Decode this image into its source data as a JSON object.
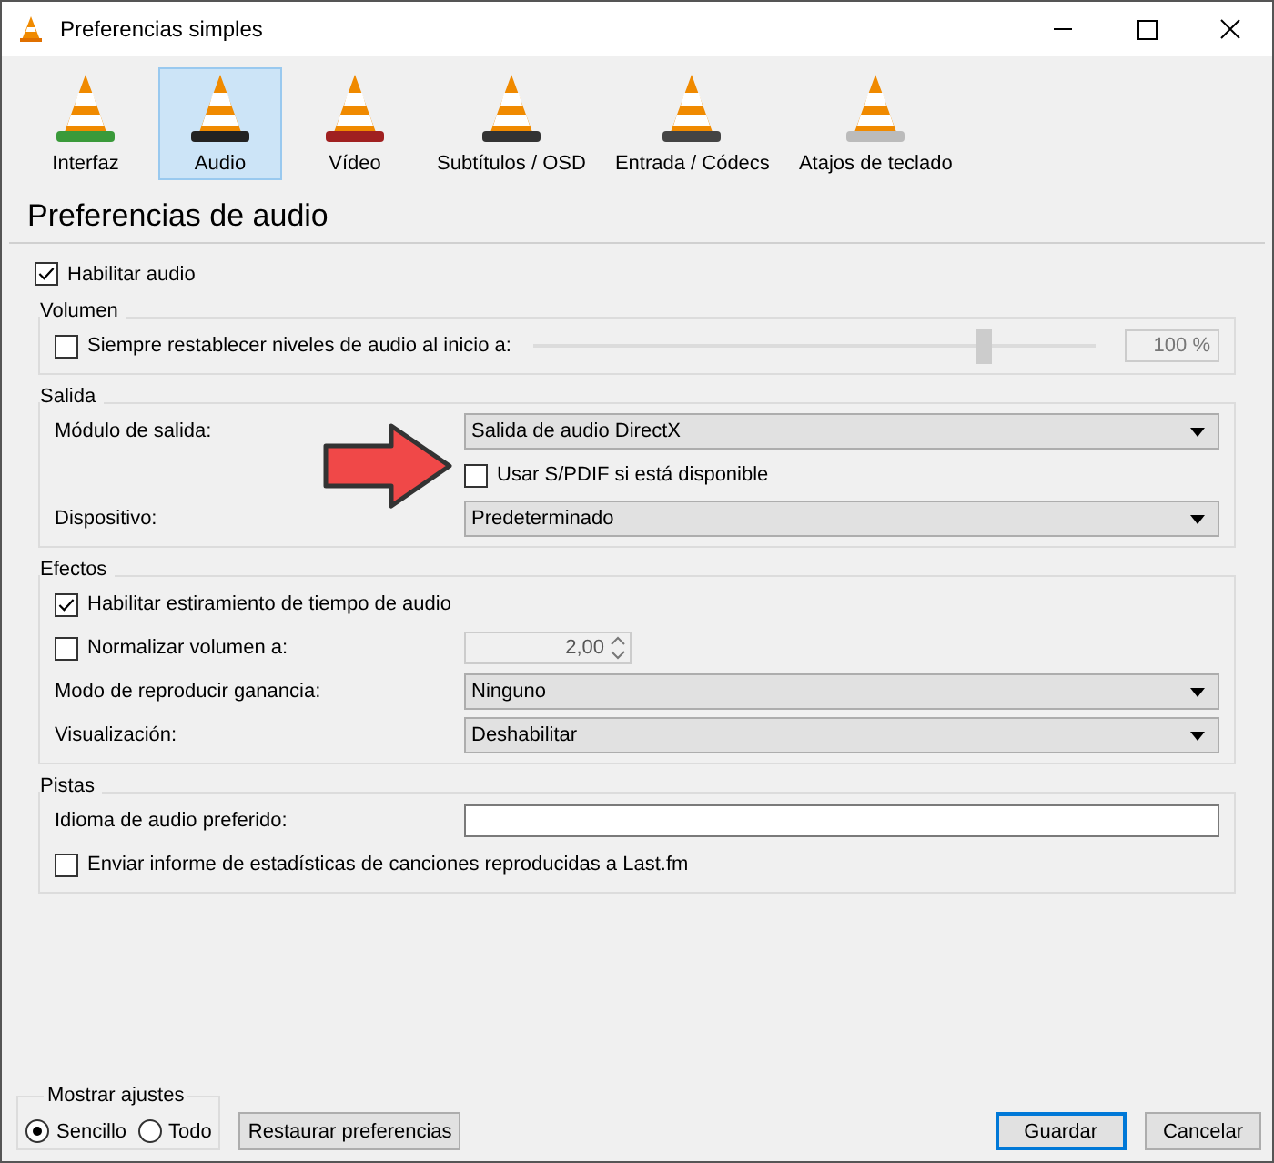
{
  "window": {
    "title": "Preferencias simples"
  },
  "categories": [
    {
      "label": "Interfaz",
      "selected": false,
      "kind": "interface"
    },
    {
      "label": "Audio",
      "selected": true,
      "kind": "audio"
    },
    {
      "label": "Vídeo",
      "selected": false,
      "kind": "video"
    },
    {
      "label": "Subtítulos / OSD",
      "selected": false,
      "kind": "subtitles"
    },
    {
      "label": "Entrada / Códecs",
      "selected": false,
      "kind": "input"
    },
    {
      "label": "Atajos de teclado",
      "selected": false,
      "kind": "hotkeys"
    }
  ],
  "heading": "Preferencias de audio",
  "enable_audio": {
    "label": "Habilitar audio",
    "checked": true
  },
  "groups": [
    {
      "title": "Volumen",
      "rows": [
        {
          "kind": "checkbox-slider",
          "label": "Siempre restablecer niveles de audio al inicio a:",
          "checked": false,
          "level": 0.8,
          "reading": "100 %"
        }
      ]
    },
    {
      "title": "Salida",
      "rows": [
        {
          "kind": "select",
          "label": "Módulo de salida:",
          "value": "Salida de audio DirectX"
        },
        {
          "kind": "subcheckbox",
          "label": "Usar S/PDIF si está disponible",
          "checked": false
        },
        {
          "kind": "select",
          "label": "Dispositivo:",
          "value": "Predeterminado"
        }
      ]
    },
    {
      "title": "Efectos",
      "rows": [
        {
          "kind": "checkbox",
          "label": "Habilitar estiramiento de tiempo de audio",
          "checked": true
        },
        {
          "kind": "checkbox-spin",
          "label": "Normalizar volumen a:",
          "checked": false,
          "value": "2,00"
        },
        {
          "kind": "select",
          "label": "Modo de reproducir ganancia:",
          "value": "Ninguno"
        },
        {
          "kind": "select",
          "label": "Visualización:",
          "value": "Deshabilitar"
        }
      ]
    },
    {
      "title": "Pistas",
      "rows": [
        {
          "kind": "text",
          "label": "Idioma de audio preferido:"
        },
        {
          "kind": "checkbox",
          "label": "Enviar informe de estadísticas de canciones reproducidas a Last.fm",
          "checked": false
        }
      ]
    }
  ],
  "show_settings": {
    "title": "Mostrar ajustes",
    "options": [
      {
        "label": "Sencillo",
        "selected": true
      },
      {
        "label": "Todo",
        "selected": false
      }
    ]
  },
  "buttons": {
    "reset": "Restaurar preferencias",
    "save": "Guardar",
    "cancel": "Cancelar"
  }
}
